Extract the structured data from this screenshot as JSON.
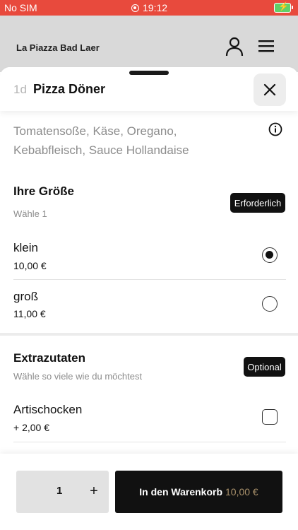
{
  "status_bar": {
    "carrier": "No SIM",
    "time": "19:12"
  },
  "app_bar": {
    "store_name": "La Piazza Bad Laer",
    "icons": [
      "user-icon",
      "menu-icon"
    ]
  },
  "product": {
    "code": "1d",
    "name": "Pizza Döner",
    "description_lines": [
      "Tomatensoße, Käse, Oregano,",
      "Kebabfleisch, Sauce Hollandaise"
    ]
  },
  "size_section": {
    "title": "Ihre Größe",
    "subtitle": "Wähle 1",
    "badge": "Erforderlich",
    "options": [
      {
        "name": "klein",
        "price": "10,00 €",
        "selected": true
      },
      {
        "name": "groß",
        "price": "11,00 €",
        "selected": false
      }
    ]
  },
  "extras_section": {
    "title": "Extrazutaten",
    "subtitle": "Wähle so viele wie du möchtest",
    "badge": "Optional",
    "options": [
      {
        "name": "Artischocken",
        "price": "+ 2,00 €",
        "checked": false
      }
    ]
  },
  "footer": {
    "quantity": "1",
    "plus": "+",
    "cart_label": "In den Warenkorb",
    "cart_price": "10,00 €"
  },
  "colors": {
    "status_bar": "#e84a3d",
    "accent_dark": "#111111",
    "price_gold": "#a8906a"
  }
}
